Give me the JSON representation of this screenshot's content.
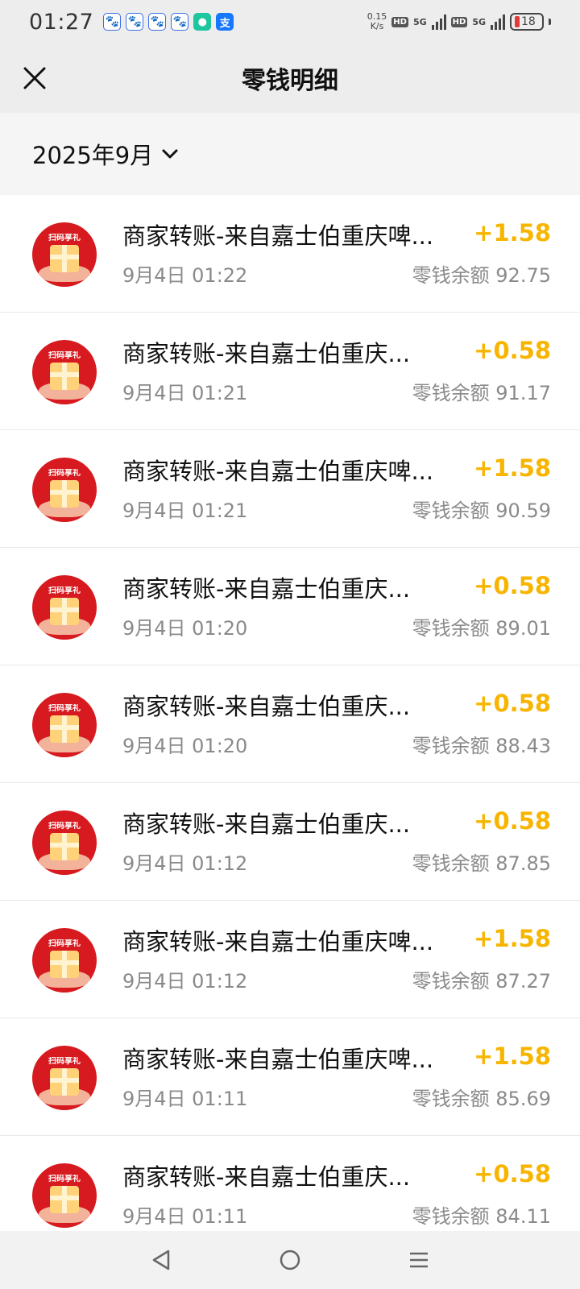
{
  "status_bar": {
    "time": "01:27",
    "net_speed_value": "0.15",
    "net_speed_unit": "K/s",
    "hd1": "HD",
    "fiveg1": "5G",
    "hd2": "HD",
    "fiveg2": "5G",
    "battery_level": "18",
    "app_icons": [
      "paw-icon",
      "paw-icon",
      "paw-icon",
      "paw-icon",
      "chat-bubble-icon",
      "alipay-icon"
    ],
    "pay_glyph": "支"
  },
  "header": {
    "title": "零钱明细"
  },
  "filter": {
    "month": "2025年9月"
  },
  "avatar_text": "扫码享礼",
  "colors": {
    "amount": "#f7b500",
    "avatar_bg": "#d71a1f",
    "background": "#ededed"
  },
  "transactions": [
    {
      "title": "商家转账-来自嘉士伯重庆啤...",
      "time": "9月4日 01:22",
      "amount": "+1.58",
      "balance": "零钱余额 92.75"
    },
    {
      "title": "商家转账-来自嘉士伯重庆...",
      "time": "9月4日 01:21",
      "amount": "+0.58",
      "balance": "零钱余额 91.17"
    },
    {
      "title": "商家转账-来自嘉士伯重庆啤...",
      "time": "9月4日 01:21",
      "amount": "+1.58",
      "balance": "零钱余额 90.59"
    },
    {
      "title": "商家转账-来自嘉士伯重庆...",
      "time": "9月4日 01:20",
      "amount": "+0.58",
      "balance": "零钱余额 89.01"
    },
    {
      "title": "商家转账-来自嘉士伯重庆...",
      "time": "9月4日 01:20",
      "amount": "+0.58",
      "balance": "零钱余额 88.43"
    },
    {
      "title": "商家转账-来自嘉士伯重庆...",
      "time": "9月4日 01:12",
      "amount": "+0.58",
      "balance": "零钱余额 87.85"
    },
    {
      "title": "商家转账-来自嘉士伯重庆啤...",
      "time": "9月4日 01:12",
      "amount": "+1.58",
      "balance": "零钱余额 87.27"
    },
    {
      "title": "商家转账-来自嘉士伯重庆啤...",
      "time": "9月4日 01:11",
      "amount": "+1.58",
      "balance": "零钱余额 85.69"
    },
    {
      "title": "商家转账-来自嘉士伯重庆...",
      "time": "9月4日 01:11",
      "amount": "+0.58",
      "balance": "零钱余额 84.11"
    }
  ],
  "nav_bar": {
    "buttons": [
      "back-triangle-icon",
      "home-circle-icon",
      "menu-lines-icon"
    ]
  }
}
